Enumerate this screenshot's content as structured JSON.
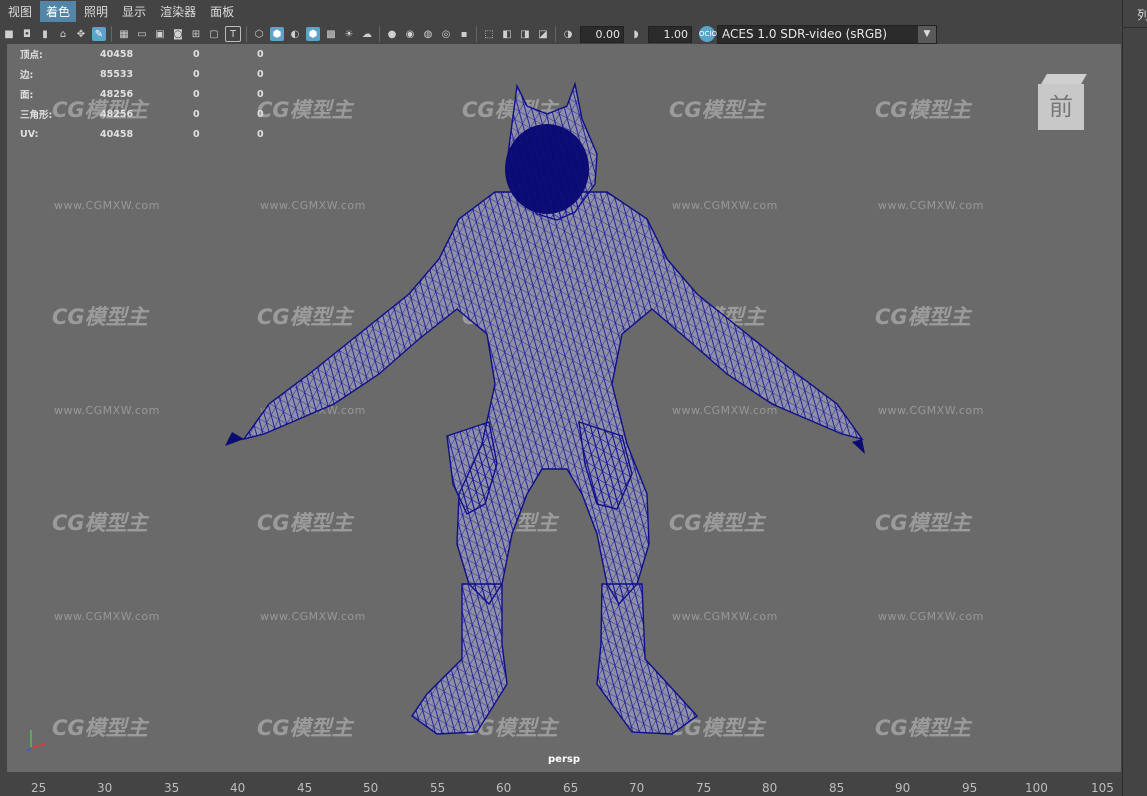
{
  "menu": [
    "视图",
    "着色",
    "照明",
    "显示",
    "渲染器",
    "面板"
  ],
  "menu_active_index": 1,
  "toolbar": {
    "exposure": "0.00",
    "gamma": "1.00",
    "colorspace": "ACES 1.0 SDR-video (sRGB)",
    "ocio_badge": "OCIO"
  },
  "hud": {
    "rows": [
      {
        "label": "顶点:",
        "v1": "40458",
        "v2": "0",
        "v3": "0"
      },
      {
        "label": "边:",
        "v1": "85533",
        "v2": "0",
        "v3": "0"
      },
      {
        "label": "面:",
        "v1": "48256",
        "v2": "0",
        "v3": "0"
      },
      {
        "label": "三角形:",
        "v1": "48256",
        "v2": "0",
        "v3": "0"
      },
      {
        "label": "UV:",
        "v1": "40458",
        "v2": "0",
        "v3": "0"
      }
    ]
  },
  "viewcube_label": "前",
  "camera_label": "persp",
  "watermark": {
    "logo": "CG模型主",
    "url": "www.CGMXW.com"
  },
  "right_panel_title": "列",
  "ruler_ticks": [
    "25",
    "30",
    "35",
    "40",
    "45",
    "50",
    "55",
    "60",
    "65",
    "70",
    "75",
    "80",
    "85",
    "90",
    "95",
    "100",
    "105"
  ],
  "colors": {
    "accent": "#5285a6",
    "viewport_bg": "#6a6a6a",
    "wire": "#0f0f8a"
  }
}
